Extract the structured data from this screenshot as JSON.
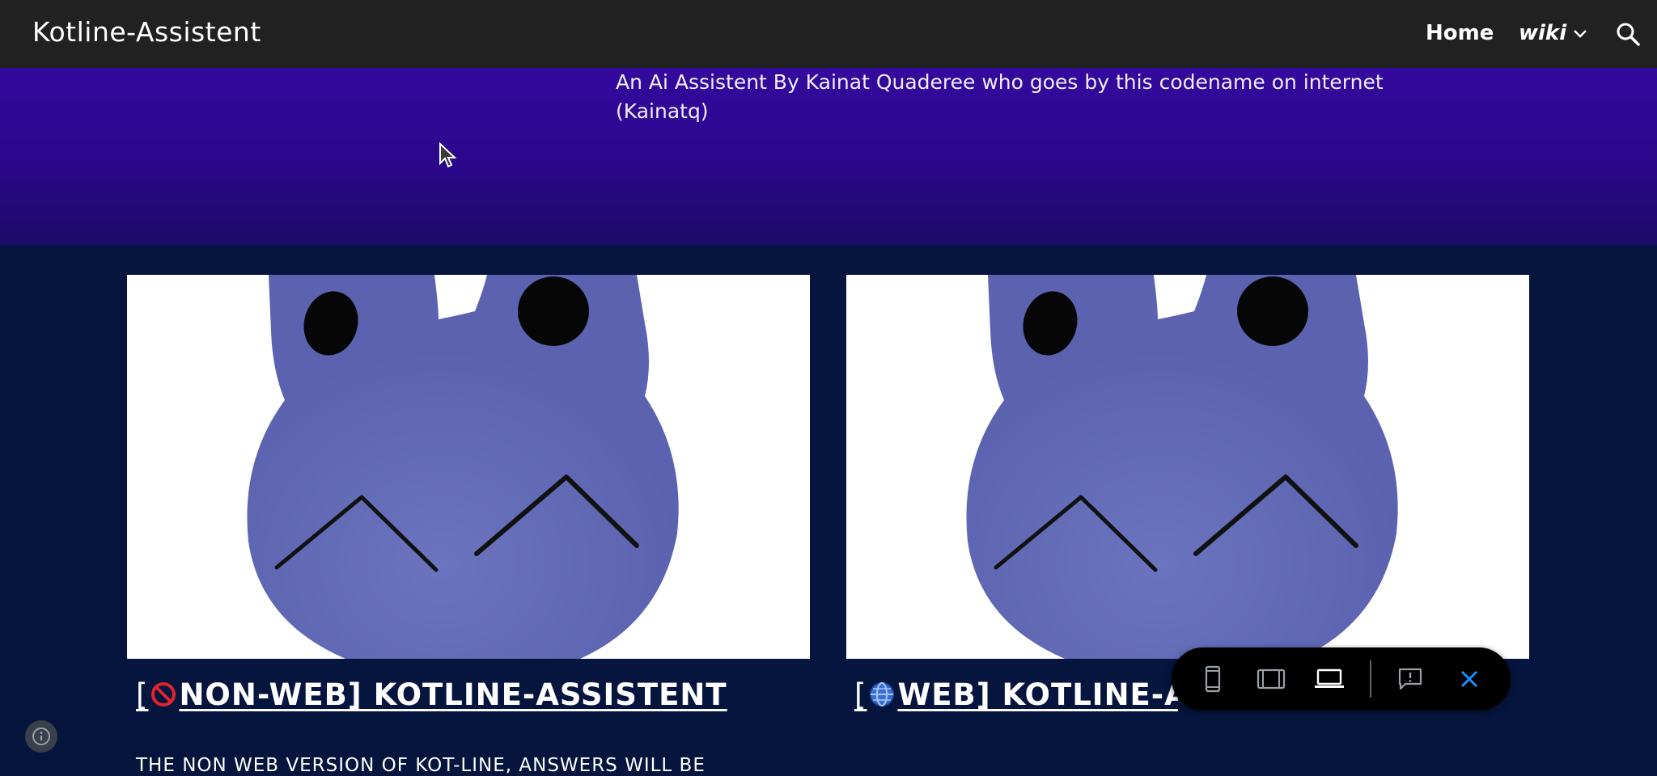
{
  "topbar": {
    "site_title": "Kotline-Assistent",
    "nav": {
      "home_label": "Home",
      "wiki_label": "wiki"
    }
  },
  "hero": {
    "description": "An Ai Assistent By Kainat Quaderee who goes by this codename on internet (Kainatq)"
  },
  "cards": [
    {
      "title_open": "[",
      "title_main": "NON-WEB] KOTLINE-ASSISTENT",
      "emoji": "prohibited-icon",
      "description": "THE NON WEB VERSION OF KOT-LINE, ANSWERS WILL BE"
    },
    {
      "title_open": "[",
      "title_main": "WEB] KOTLINE-ASSISTENT",
      "emoji": "globe-icon"
    }
  ],
  "colors": {
    "topbar": "#212121",
    "hero_top": "#34099e",
    "page_bg": "#05153d",
    "frog_body": "#5c66b2",
    "preview_close": "#1a8fff"
  },
  "preview_toolbar": {
    "buttons": [
      "phone-icon",
      "tablet-icon",
      "laptop-icon",
      "feedback-icon",
      "close-icon"
    ],
    "active": "laptop-icon"
  }
}
